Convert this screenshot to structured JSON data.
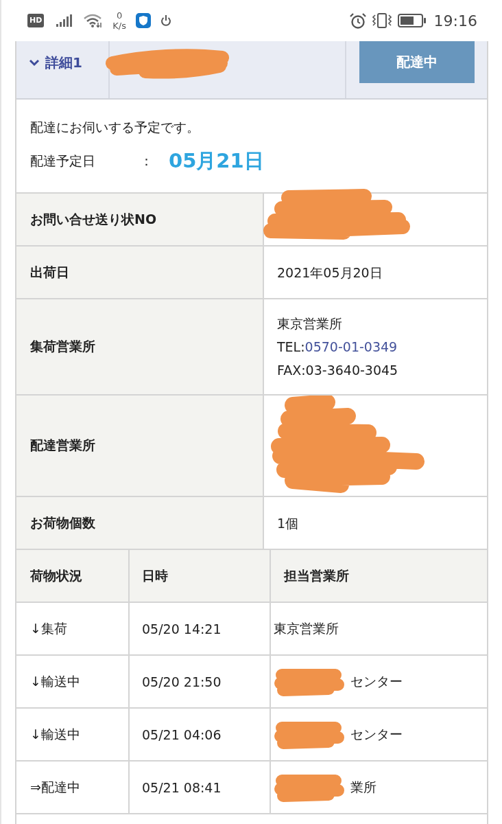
{
  "status_bar": {
    "hd_badge": "HD",
    "net_speed_value": "0",
    "net_speed_unit": "K/s",
    "time": "19:16"
  },
  "detail_header": {
    "title": "詳細1",
    "expanded": true,
    "title_redacted": true,
    "status_button": "配達中"
  },
  "delivery_notice": {
    "message": "配達にお伺いする予定です。",
    "date_label": "配達予定日",
    "separator": "：",
    "date_value": "05月21日"
  },
  "details": [
    {
      "label": "お問い合せ送り状NO",
      "redacted": true,
      "kind": "short"
    },
    {
      "label": "出荷日",
      "redacted": false,
      "lines": [
        {
          "text": "2021年05月20日"
        }
      ]
    },
    {
      "label": "集荷営業所",
      "redacted": false,
      "lines": [
        {
          "text": "東京営業所"
        },
        {
          "text": "TEL:",
          "link": "0570-01-0349"
        },
        {
          "text": "FAX:03-3640-3045"
        }
      ]
    },
    {
      "label": "配達営業所",
      "redacted": true,
      "kind": "tall"
    },
    {
      "label": "お荷物個数",
      "redacted": false,
      "lines": [
        {
          "text": "1個"
        }
      ]
    }
  ],
  "tracking": {
    "columns": [
      "荷物状況",
      "日時",
      "担当営業所"
    ],
    "rows": [
      {
        "status": "↓集荷",
        "time": "05/20 14:21",
        "office": "東京営業所",
        "office_redacted": false
      },
      {
        "status": "↓輸送中",
        "time": "05/20 21:50",
        "office": "センター",
        "office_redacted": true
      },
      {
        "status": "↓輸送中",
        "time": "05/21 04:06",
        "office": "センター",
        "office_redacted": true
      },
      {
        "status": "⇒配達中",
        "time": "05/21 08:41",
        "office": "業所",
        "office_redacted": true
      }
    ]
  }
}
